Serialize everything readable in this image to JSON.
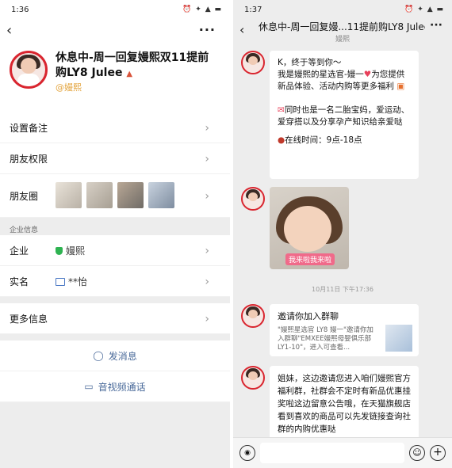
{
  "left": {
    "status": {
      "time": "1:36",
      "icons": "⏰ ✦ ▲ ▬"
    },
    "nav": {
      "back_icon": "back-icon",
      "more": "···"
    },
    "profile": {
      "name": "休息中-周一回复嫚熙双11提前购LY8 Julee",
      "name_flag": "▲",
      "corp": "@嫚熙"
    },
    "rows": {
      "remark": "设置备注",
      "permissions": "朋友权限",
      "moments": "朋友圈"
    },
    "company_section": {
      "header": "企业信息",
      "company_label": "企业",
      "company_value": "嫚熙",
      "realname_label": "实名",
      "realname_value": "**怡"
    },
    "more_info": "更多信息",
    "actions": {
      "message": "发消息",
      "video_call": "音视频通话"
    }
  },
  "right": {
    "status": {
      "time": "1:37",
      "icons": "⏰ ✦ ▲ ▬"
    },
    "header": {
      "title": "休息中-周一回复嫚...11提前购LY8 Julee",
      "subtitle": "嫚熙",
      "more": "···"
    },
    "messages": {
      "m1": {
        "line1": "K，终于等到你～",
        "line2a": "我是嫚熙的星选官-嫚一",
        "line2b": "为您提供新品体验、活动内购等更多福利",
        "line3": "同时也是一名二胎宝妈，爱运动、爱穿搭以及分享孕产知识给亲爱哒",
        "line4": "在线时间：9点-18点"
      },
      "m2": {
        "caption": "我来啦我来啦"
      },
      "timestamp": "10月11日 下午17:36",
      "m3": {
        "title": "邀请你加入群聊",
        "desc": "\"嫚熙星选官 LY8 嫚一\"邀请你加入群聊\"EMXEE嫚熙母婴俱乐部LY1-10\"，进入可查看..."
      },
      "m4": {
        "text": "姐妹，这边邀请您进入咱们嫚熙官方福利群，社群会不定时有新品优惠挂奖啦这边留意公告哦，在天猫旗舰店看到喜欢的商品可以先发链接查询社群的内购优惠哒"
      }
    },
    "input": {
      "voice": "◉",
      "emoji": "☺",
      "plus": "+"
    }
  }
}
